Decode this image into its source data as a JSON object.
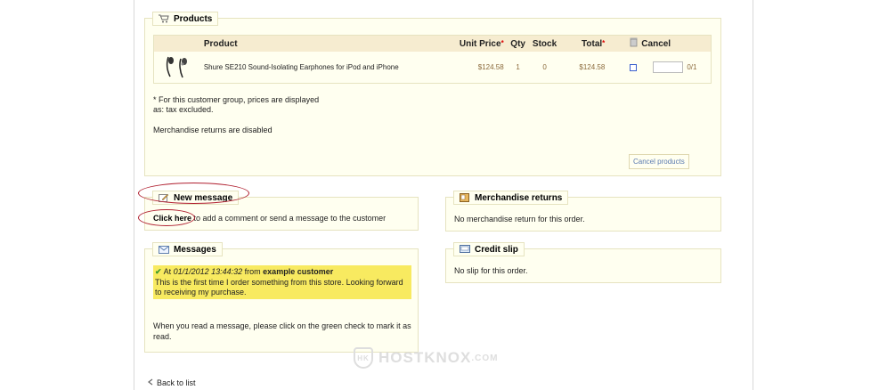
{
  "products": {
    "legend": "Products",
    "headers": {
      "product": "Product",
      "unit_price": "Unit Price",
      "qty": "Qty",
      "stock": "Stock",
      "total": "Total",
      "cancel": "Cancel"
    },
    "row": {
      "name": "Shure SE210 Sound-Isolating Earphones for iPod and iPhone",
      "unit_price": "$124.58",
      "qty": "1",
      "stock": "0",
      "total": "$124.58",
      "cancel_count": "0/1"
    },
    "note_line1": "* For this customer group, prices are displayed",
    "note_line2": "as: tax excluded.",
    "returns_note": "Merchandise returns are disabled",
    "cancel_button": "Cancel products"
  },
  "new_message": {
    "legend": "New message",
    "link": "Click here",
    "text": " to add a comment or send a message to the customer"
  },
  "messages": {
    "legend": "Messages",
    "at": "At ",
    "date": "01/1/2012 13:44:32",
    "from": " from ",
    "author": "example customer",
    "body": "This is the first time I order something from this store. Looking forward to receiving my purchase.",
    "hint": "When you read a message, please click on the green check to mark it as read."
  },
  "merchandise_returns": {
    "legend": "Merchandise returns",
    "text": "No merchandise return for this order."
  },
  "credit_slip": {
    "legend": "Credit slip",
    "text": "No slip for this order."
  },
  "footer": {
    "back_link": "Back to list"
  },
  "watermark": {
    "text": "HOSTKNOX",
    "suffix": ".COM",
    "badge": "HK"
  }
}
